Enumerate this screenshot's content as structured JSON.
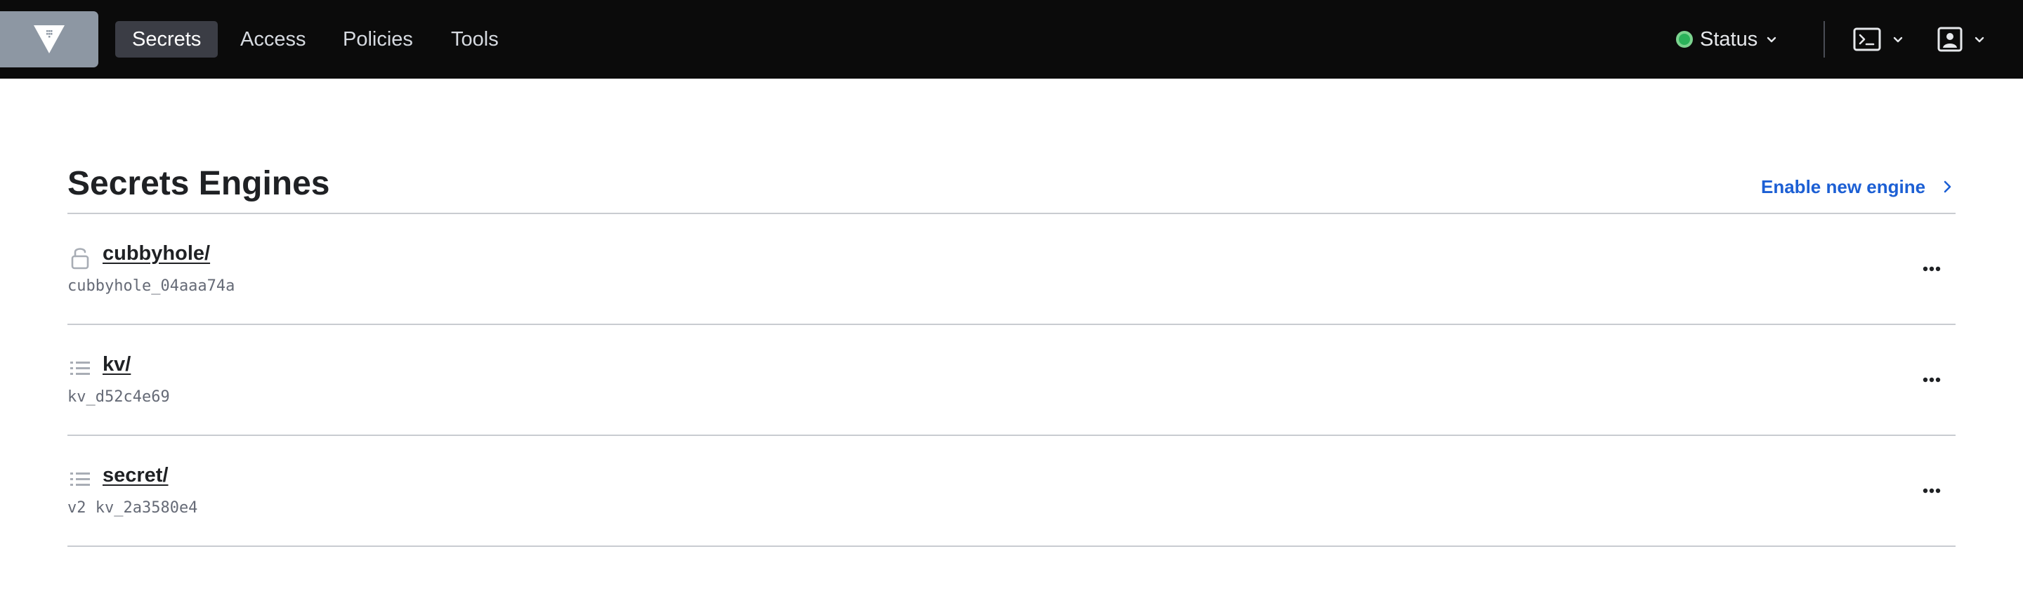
{
  "nav": {
    "logo_icon": "vault-logo-icon",
    "items": [
      {
        "label": "Secrets",
        "active": true
      },
      {
        "label": "Access",
        "active": false
      },
      {
        "label": "Policies",
        "active": false
      },
      {
        "label": "Tools",
        "active": false
      }
    ],
    "status": {
      "label": "Status",
      "color": "#2bb25a"
    },
    "console_icon": "terminal-icon",
    "user_icon": "user-icon"
  },
  "main": {
    "title": "Secrets Engines",
    "enable_link": "Enable new engine",
    "engines": [
      {
        "name": "cubbyhole/",
        "description": "cubbyhole_04aaa74a",
        "icon": "lock-icon"
      },
      {
        "name": "kv/",
        "description": "kv_d52c4e69",
        "icon": "list-icon"
      },
      {
        "name": "secret/",
        "description": "v2 kv_2a3580e4",
        "icon": "list-icon"
      }
    ]
  },
  "colors": {
    "nav_bg": "#0b0b0b",
    "accent_link": "#1c5fd4",
    "status_ok": "#2bb25a"
  }
}
